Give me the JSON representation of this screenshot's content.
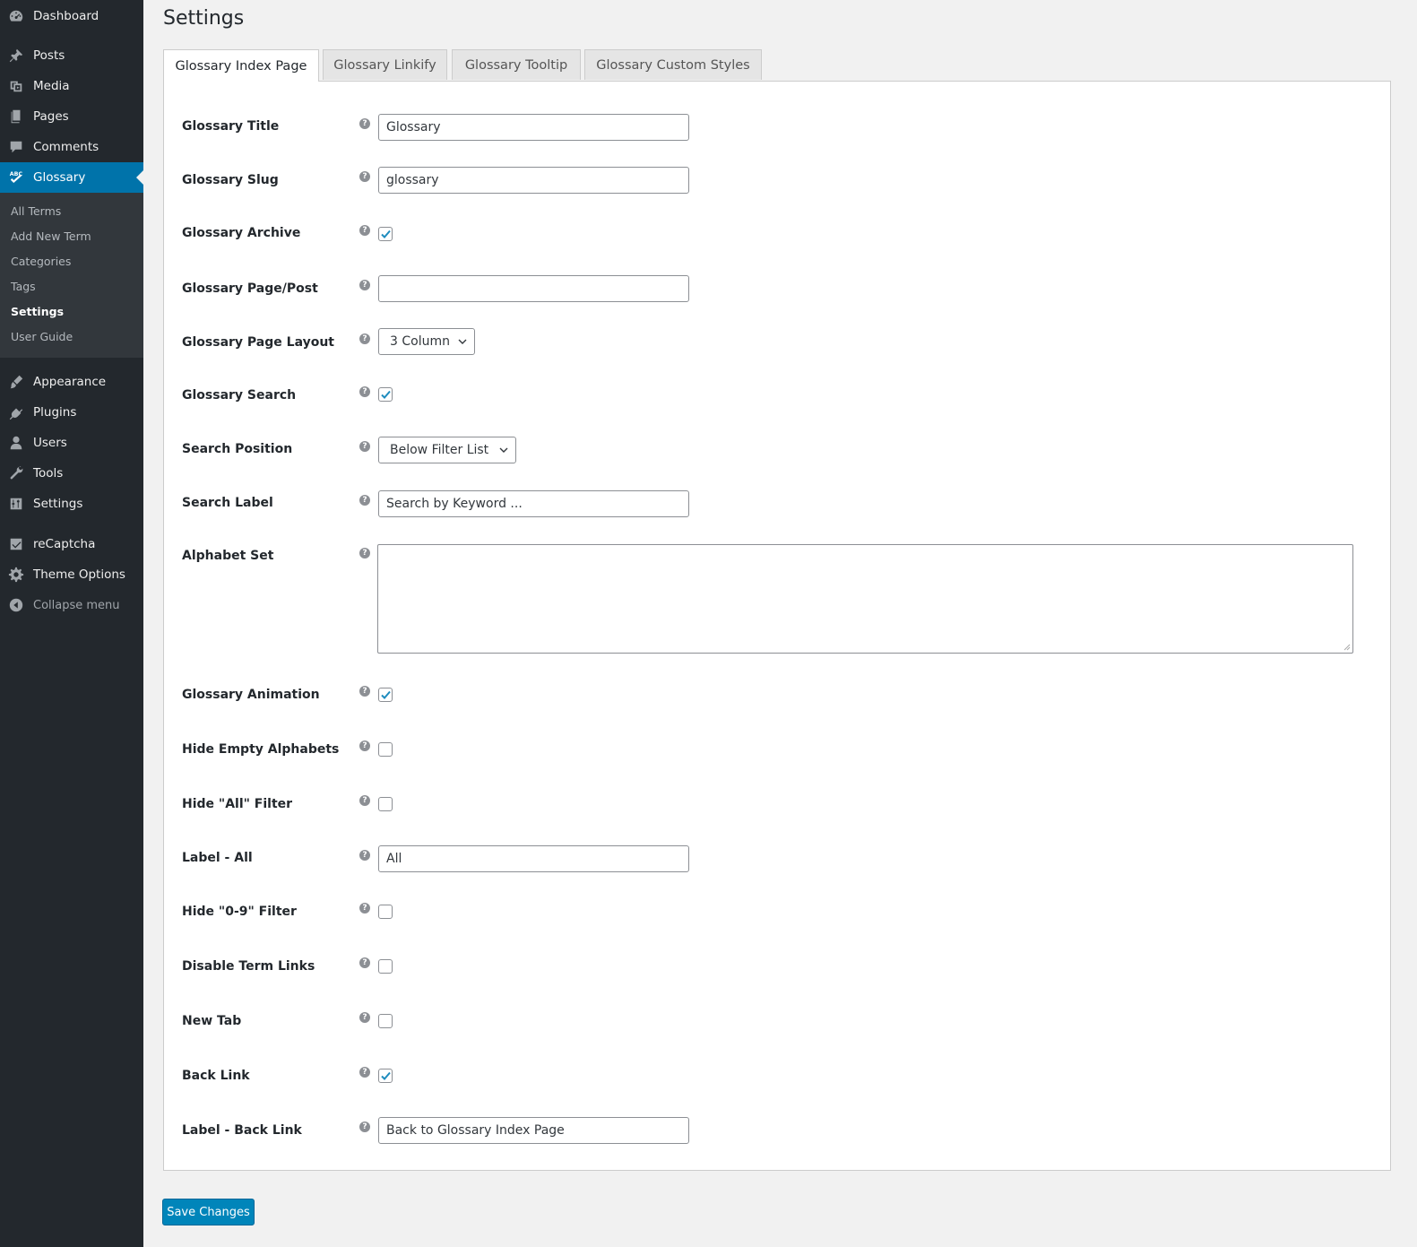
{
  "sidebar": {
    "menu": {
      "dashboard": "Dashboard",
      "posts": "Posts",
      "media": "Media",
      "pages": "Pages",
      "comments": "Comments",
      "glossary": "Glossary",
      "appearance": "Appearance",
      "plugins": "Plugins",
      "users": "Users",
      "tools": "Tools",
      "settings": "Settings",
      "recaptcha": "reCaptcha",
      "theme_options": "Theme Options",
      "collapse": "Collapse menu"
    },
    "glossary_icon_text": "ABC",
    "submenu": [
      "All Terms",
      "Add New Term",
      "Categories",
      "Tags",
      "Settings",
      "User Guide"
    ],
    "current_submenu": "Settings"
  },
  "page": {
    "title": "Settings",
    "tabs": [
      "Glossary Index Page",
      "Glossary Linkify",
      "Glossary Tooltip",
      "Glossary Custom Styles"
    ],
    "active_tab": "Glossary Index Page",
    "help_glyph": "?"
  },
  "fields": {
    "glossary_title": {
      "label": "Glossary Title",
      "value": "Glossary"
    },
    "glossary_slug": {
      "label": "Glossary Slug",
      "value": "glossary"
    },
    "glossary_archive": {
      "label": "Glossary Archive",
      "checked": true
    },
    "glossary_page_post": {
      "label": "Glossary Page/Post",
      "value": ""
    },
    "glossary_page_layout": {
      "label": "Glossary Page Layout",
      "value": "3 Column"
    },
    "glossary_search": {
      "label": "Glossary Search",
      "checked": true
    },
    "search_position": {
      "label": "Search Position",
      "value": "Below Filter List"
    },
    "search_label": {
      "label": "Search Label",
      "value": "Search by Keyword ..."
    },
    "alphabet_set": {
      "label": "Alphabet Set",
      "value": ""
    },
    "glossary_animation": {
      "label": "Glossary Animation",
      "checked": true
    },
    "hide_empty_alphabets": {
      "label": "Hide Empty Alphabets",
      "checked": false
    },
    "hide_all_filter": {
      "label": "Hide \"All\" Filter",
      "checked": false
    },
    "label_all": {
      "label": "Label - All",
      "value": "All"
    },
    "hide_09_filter": {
      "label": "Hide \"0-9\" Filter",
      "checked": false
    },
    "disable_term_links": {
      "label": "Disable Term Links",
      "checked": false
    },
    "new_tab": {
      "label": "New Tab",
      "checked": false
    },
    "back_link": {
      "label": "Back Link",
      "checked": true
    },
    "label_back_link": {
      "label": "Label - Back Link",
      "value": "Back to Glossary Index Page"
    }
  },
  "actions": {
    "save": "Save Changes"
  },
  "colors": {
    "accent": "#0073aa",
    "sidebar_bg": "#23282d",
    "button": "#0085ba"
  }
}
